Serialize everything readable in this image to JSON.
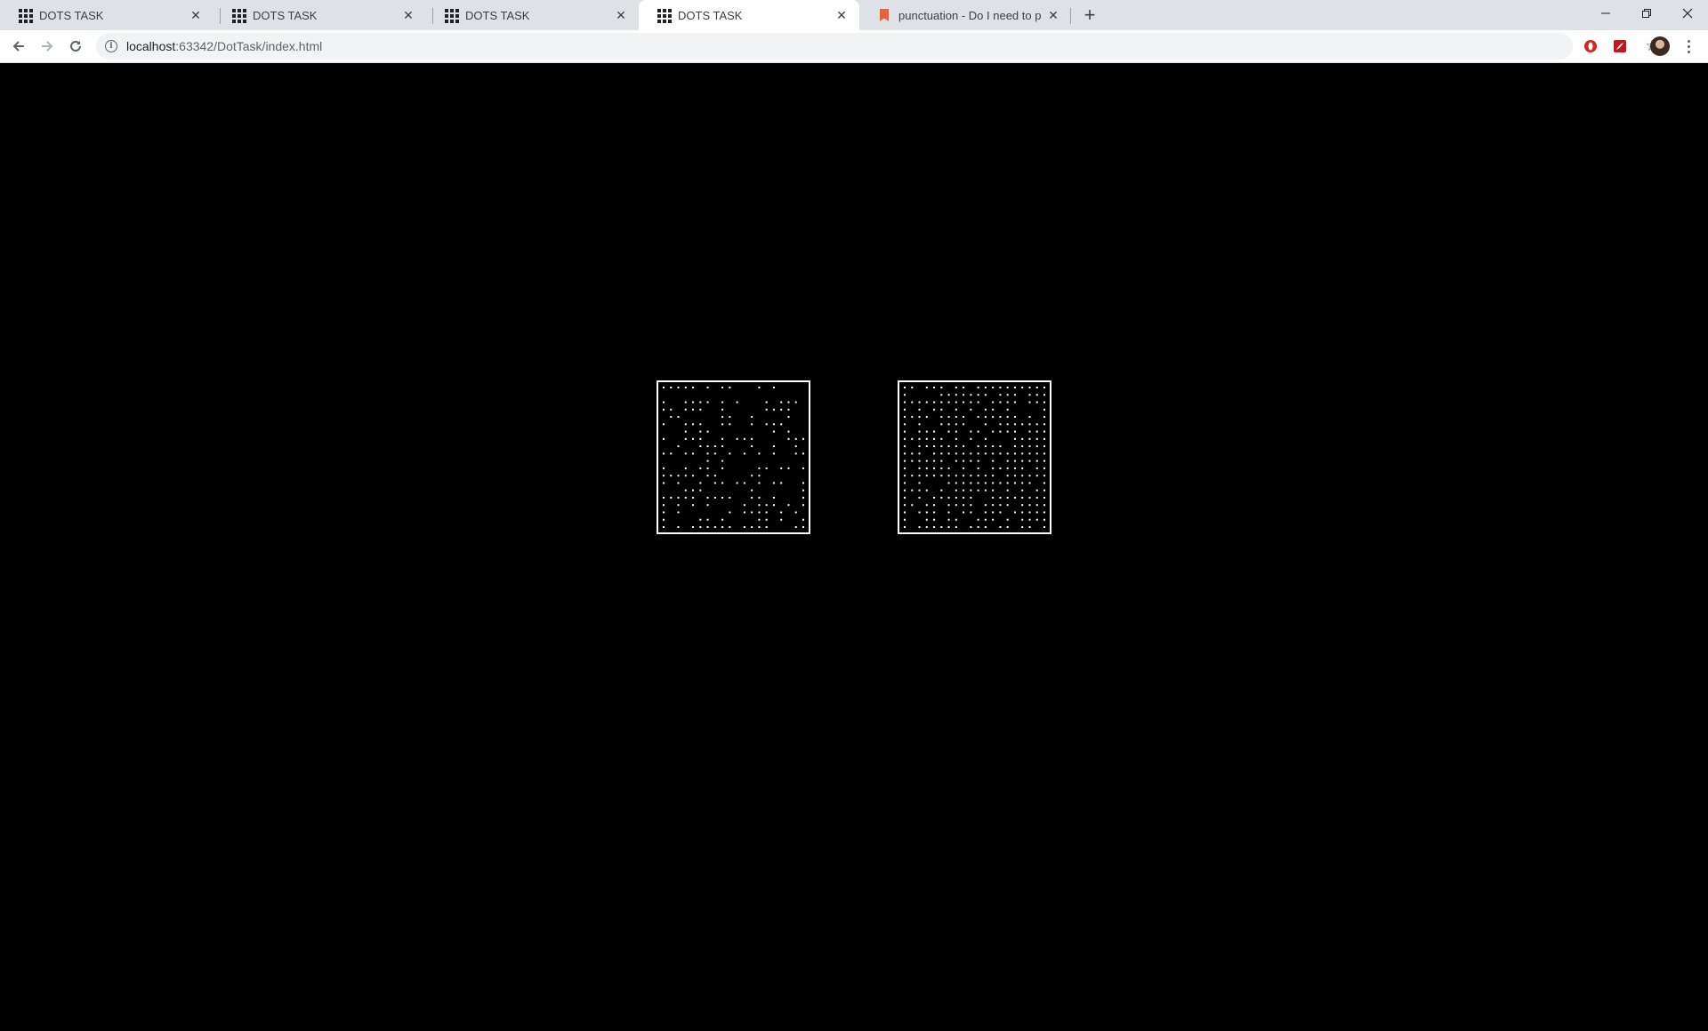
{
  "browser": {
    "tabs": [
      {
        "title": "DOTS TASK",
        "favicon": "grid-icon",
        "active": false
      },
      {
        "title": "DOTS TASK",
        "favicon": "grid-icon",
        "active": false
      },
      {
        "title": "DOTS TASK",
        "favicon": "grid-icon",
        "active": false
      },
      {
        "title": "DOTS TASK",
        "favicon": "grid-icon",
        "active": true
      },
      {
        "title": "punctuation - Do I need to put co",
        "favicon": "bookmark-icon",
        "active": false
      }
    ],
    "close_glyph": "✕",
    "new_tab_glyph": "+",
    "window_controls": {
      "minimize": "—",
      "restore": "❐",
      "close": "✕"
    },
    "address": {
      "host": "localhost",
      "path": ":63342/DotTask/index.html"
    },
    "colors": {
      "tabstrip": "#dee1e6",
      "active_tab": "#ffffff",
      "omnibox": "#f1f3f4",
      "page_background": "#000000",
      "dots": "#ffffff"
    }
  },
  "dots_task": {
    "left_box": {
      "rows": [
        "11111010110001010000",
        "00000000000000000000",
        "10011110101000101110",
        "11011100100000111100",
        "01100000110010000100",
        "10011100110010111000",
        "00010110000000010100",
        "10011100101110000111",
        "00100111100010010010",
        "11011011010101010011",
        "00000010100000000000",
        "10010110100001101101",
        "11111011000011000000",
        "10100101101101011001",
        "00011100000010000001",
        "11111011110011010001",
        "10101010000101110101",
        "10100000010111101010",
        "10000110100001101001",
        "10101111110111100011"
      ]
    },
    "right_box": {
      "rows": [
        "11011101101111111111",
        "10000111111101110111",
        "11111111111011110111",
        "10101101010110100001",
        "11110111101111110101",
        "10100111100101111111",
        "10111011011011110111",
        "11111101010100011111",
        "10111111101111011111",
        "11101111111111111111",
        "11111101111010111111",
        "10111110101011111011",
        "11111111111110111111",
        "10100011111111111101",
        "11110101111110101011",
        "10101111110011111111",
        "11011011110111101111",
        "10111010110111011111",
        "10011011001110101111",
        "10111111011101101101"
      ]
    }
  }
}
